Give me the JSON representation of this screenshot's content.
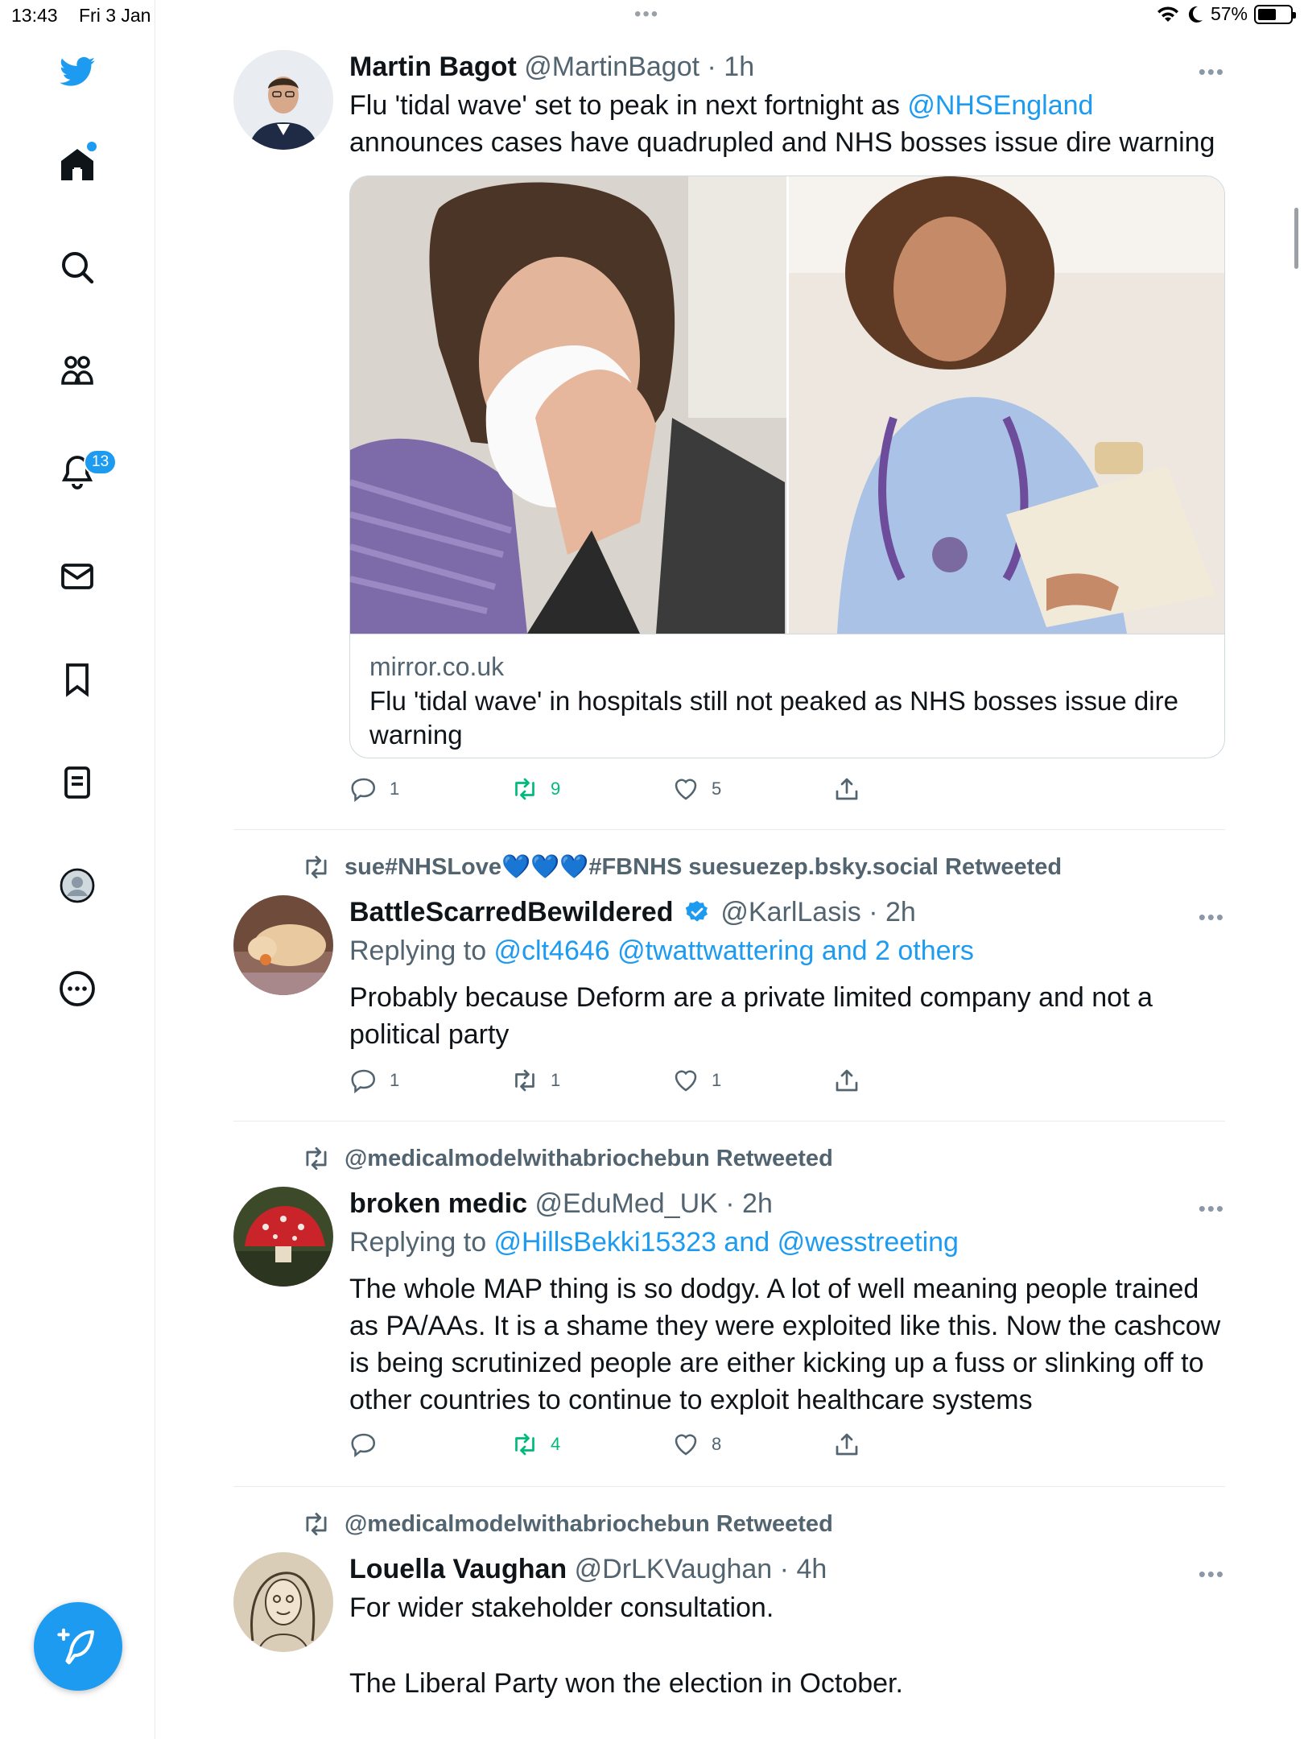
{
  "status_bar": {
    "time": "13:43",
    "date": "Fri 3 Jan",
    "battery": "57%",
    "battery_level": 0.57
  },
  "sidebar": {
    "notifications_badge": "13",
    "items": [
      "twitter-logo",
      "home-icon",
      "search-icon",
      "communities-icon",
      "bell-icon",
      "mail-icon",
      "bookmark-icon",
      "lists-icon",
      "profile-icon",
      "more-icon"
    ]
  },
  "colors": {
    "accent": "#1d9bf0",
    "retweet_green": "#00ba7c",
    "muted": "#536471"
  },
  "tweets": [
    {
      "name": "Martin Bagot",
      "handle": "@MartinBagot",
      "time": "· 1h",
      "text_before": "Flu 'tidal wave' set to peak in next fortnight as ",
      "mention": "@NHSEngland",
      "text_after": " announces cases have quadrupled and NHS bosses issue dire warning",
      "card": {
        "domain": "mirror.co.uk",
        "title": "Flu 'tidal wave' in hospitals still not peaked as NHS bosses issue dire warning"
      },
      "replies": "1",
      "retweets": "9",
      "likes": "5"
    },
    {
      "retweeted_by_prefix": "sue#NHSLove",
      "retweeted_by_hearts": "💙💙💙",
      "retweeted_by_suffix": "#FBNHS suesuezep.bsky.social Retweeted",
      "name": "BattleScarredBewildered",
      "handle": "@KarlLasis",
      "time": "· 2h",
      "replying_prefix": "Replying to ",
      "replying_to": "@clt4646 @twattwattering and 2 others",
      "text": "Probably because Deform are a private limited company and not a political party",
      "replies": "1",
      "retweets": "1",
      "likes": "1"
    },
    {
      "retweeted_by": "@medicalmodelwithabriochebun Retweeted",
      "name": "broken medic",
      "handle": "@EduMed_UK",
      "time": "· 2h",
      "replying_prefix": "Replying to ",
      "replying_to": "@HillsBekki15323 and @wesstreeting",
      "text": "The whole MAP thing is so dodgy. A lot of well meaning people trained as PA/AAs. It is a shame they were exploited like this. Now the cashcow is being scrutinized people are either kicking up a fuss or slinking off to other countries to continue to exploit healthcare systems",
      "replies": "",
      "retweets": "4",
      "likes": "8"
    },
    {
      "retweeted_by": "@medicalmodelwithabriochebun Retweeted",
      "name": "Louella Vaughan",
      "handle": "@DrLKVaughan",
      "time": "· 4h",
      "text_line1": "For wider stakeholder consultation.",
      "text_line2": "The Liberal Party won the election in October."
    }
  ]
}
